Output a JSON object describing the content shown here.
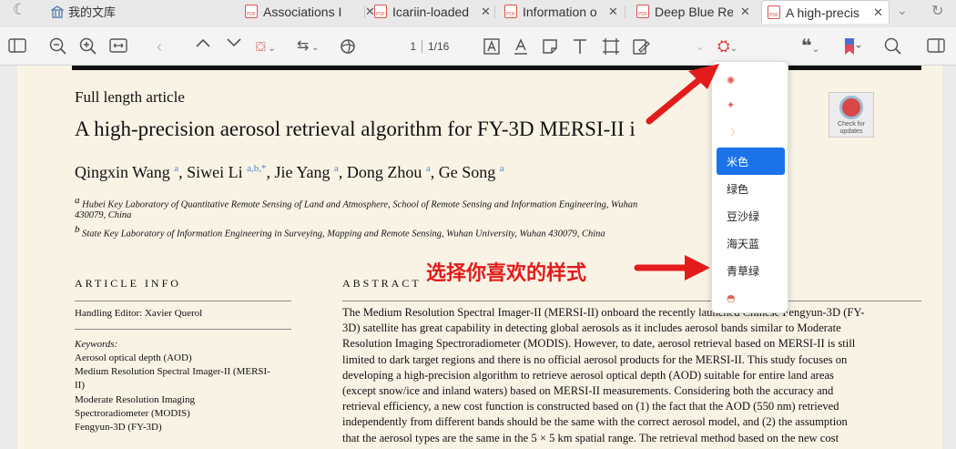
{
  "tabbar": {
    "library_label": "我的文库",
    "tabs": [
      {
        "label": "Associations I"
      },
      {
        "label": "Icariin-loaded"
      },
      {
        "label": "Information o"
      },
      {
        "label": "Deep Blue Re"
      },
      {
        "label": "A high-precis"
      }
    ]
  },
  "toolbar": {
    "page_current": "1",
    "page_total": "1/16"
  },
  "document": {
    "article_type": "Full length article",
    "title": "A high-precision aerosol retrieval algorithm for FY-3D MERSI-II i",
    "authors": [
      {
        "name": "Qingxin Wang",
        "sup": "a"
      },
      {
        "name": "Siwei Li",
        "sup": "a,b,*"
      },
      {
        "name": "Jie Yang",
        "sup": "a"
      },
      {
        "name": "Dong Zhou",
        "sup": "a"
      },
      {
        "name": "Ge Song",
        "sup": "a"
      }
    ],
    "affiliations": [
      {
        "sup": "a",
        "text": "Hubei Key Laboratory of Quantitative Remote Sensing of Land and Atmosphere, School of Remote Sensing and Information Engineering, Wuhan"
      },
      {
        "sup": "",
        "text": "430079, China"
      },
      {
        "sup": "b",
        "text": "State Key Laboratory of Information Engineering in Surveying, Mapping and Remote Sensing, Wuhan University, Wuhan 430079, China"
      }
    ],
    "check_updates": "Check for updates",
    "article_info_heading": "ARTICLE INFO",
    "abstract_heading": "ABSTRACT",
    "handling_editor": "Handling Editor: Xavier Querol",
    "keywords_label": "Keywords:",
    "keywords": [
      "Aerosol optical depth (AOD)",
      "Medium Resolution Spectral Imager-II (MERSI-",
      "II)",
      "Moderate Resolution Imaging",
      "Spectroradiometer (MODIS)",
      "Fengyun-3D (FY-3D)"
    ],
    "abstract_lines": [
      "The Medium Resolution Spectral Imager-II (MERSI-II) onboard the recently launched Chinese Fengyun-3D (FY-",
      "3D) satellite has great capability in detecting global aerosols as it includes aerosol bands similar to Moderate",
      "Resolution Imaging Spectroradiometer (MODIS). However, to date, aerosol retrieval based on MERSI-II is still",
      "limited to dark target regions and there is no official aerosol products for the MERSI-II. This study focuses on",
      "developing a high-precision algorithm to retrieve aerosol optical depth (AOD) suitable for entire land areas",
      "(except snow/ice and inland waters) based on MERSI-II measurements. Considering both the accuracy and",
      "retrieval efficiency, a new cost function is constructed based on (1) the fact that the AOD (550 nm) retrieved",
      "independently from different bands should be the same with the correct aerosol model, and (2) the assumption",
      "that the aerosol types are the same in the 5 × 5 km spatial range. The retrieval method based on the new cost"
    ]
  },
  "theme_menu": {
    "items": [
      {
        "label": "",
        "icon": "sun-icon"
      },
      {
        "label": "",
        "icon": "sparkle-icon"
      },
      {
        "label": "",
        "icon": "moon-icon"
      },
      {
        "label": "米色",
        "selected": true
      },
      {
        "label": "绿色"
      },
      {
        "label": "豆沙绿"
      },
      {
        "label": "海天蓝"
      },
      {
        "label": "青草绿"
      },
      {
        "label": "",
        "icon": "palette-icon"
      }
    ]
  },
  "annotation": {
    "text": "选择你喜欢的样式",
    "color": "#e31b1b"
  },
  "colors": {
    "page_bg": "#f9f3e6",
    "accent_blue": "#1a73e8",
    "link_blue": "#4a8ad1",
    "pdf_red": "#d9534f"
  }
}
